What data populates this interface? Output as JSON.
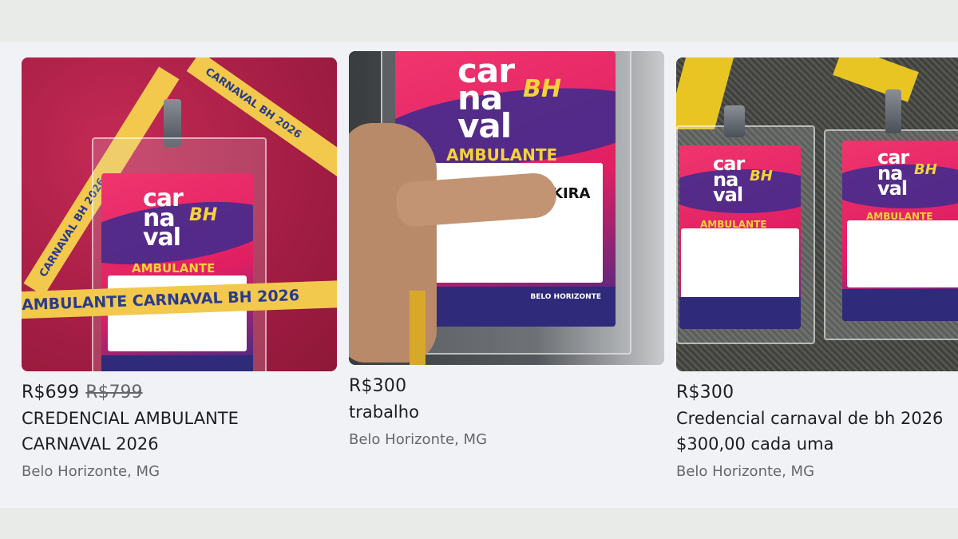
{
  "listings": [
    {
      "price": "R$699",
      "old_price": "R$799",
      "title_line1": "CREDENCIAL AMBULANTE",
      "title_line2": "CARNAVAL 2026",
      "location": "Belo Horizonte, MG",
      "photo": {
        "badge_logo": "car\nna\nval",
        "badge_bh": "BH",
        "badge_role": "AMBULANTE",
        "lanyard_text": "AMBULANTE CARNAVAL BH 2026",
        "lanyard_text_2": "CARNAVAL BH 2026"
      }
    },
    {
      "price": "R$300",
      "title_line1": "trabalho",
      "location": "Belo Horizonte, MG",
      "photo": {
        "badge_logo": "car\nna\nval",
        "badge_bh": "BH",
        "badge_role": "AMBULANTE",
        "name_fragment": "KIRA",
        "sponsor": "BELO HORIZONTE"
      }
    },
    {
      "price": "R$300",
      "title_line1": "Credencial carnaval de bh 2026",
      "title_line2": "$300,00 cada uma",
      "location": "Belo Horizonte, MG",
      "photo": {
        "badge_logo": "car\nna\nval",
        "badge_bh": "BH",
        "badge_role": "AMBULANTE"
      }
    }
  ],
  "colors": {
    "page_bg": "#e9ebe8",
    "panel_bg": "#f0f2f5",
    "text_primary": "#1c1e21",
    "text_secondary": "#65676b",
    "badge_pink": "#e01f62",
    "badge_navy": "#2f2a7a",
    "lanyard_yellow": "#f2c94c"
  }
}
